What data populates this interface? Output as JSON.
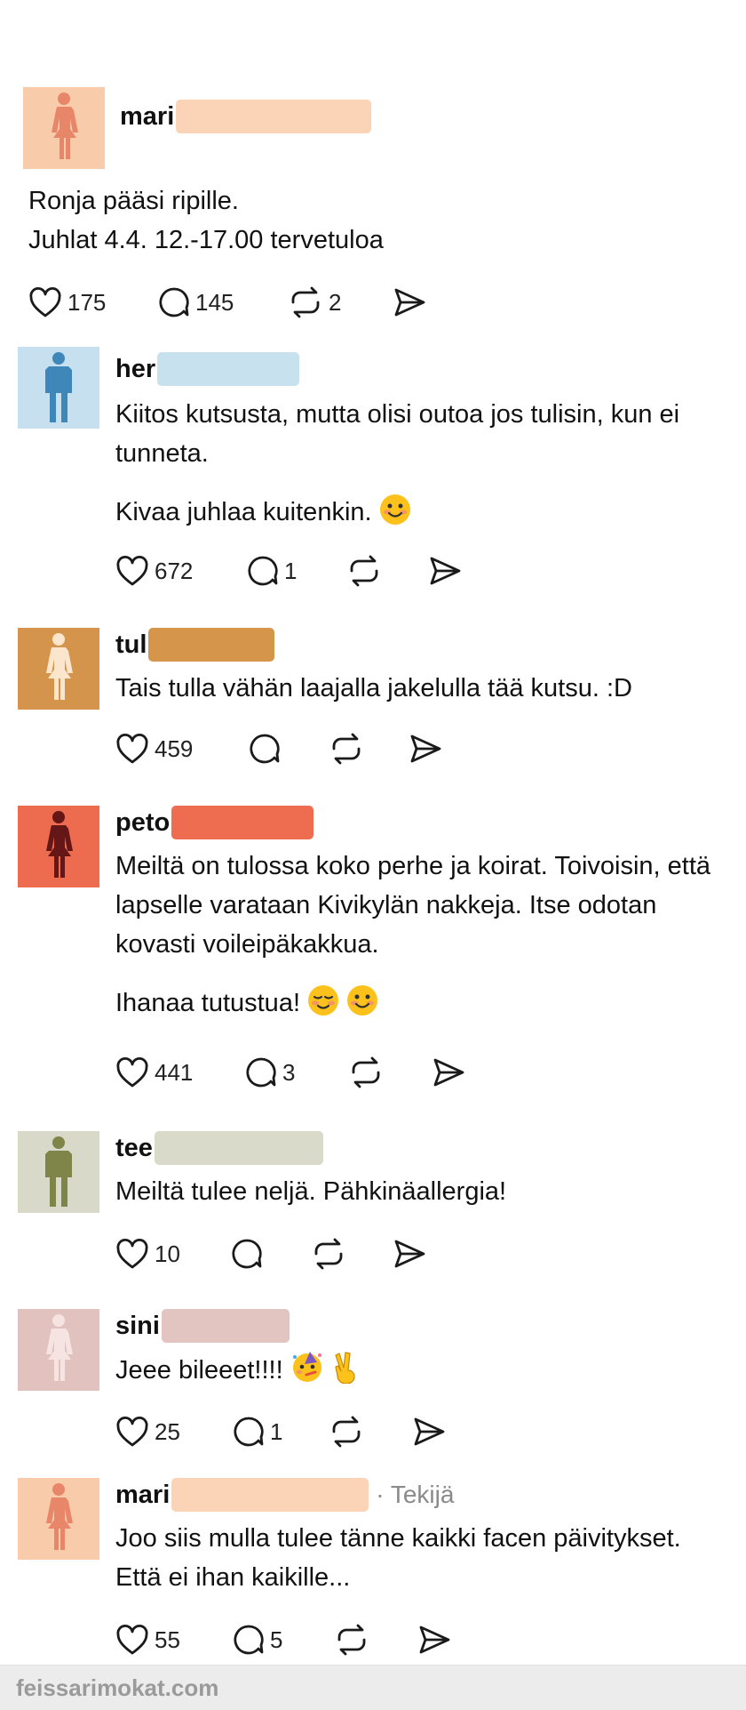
{
  "post": {
    "username_visible": "mari",
    "lines": [
      "Ronja pääsi ripille.",
      "Juhlat 4.4. 12.-17.00 tervetuloa"
    ],
    "likes": "175",
    "comments": "145",
    "reposts": "2",
    "avatar_color": "#f8ccab",
    "figure_color": "#e8866a",
    "blur_color": "#fbd3b7"
  },
  "replies": [
    {
      "username_visible": "her",
      "paragraphs": [
        "Kiitos kutsusta, mutta olisi outoa jos tulisin, kun ei tunneta.",
        "Kivaa juhlaa kuitenkin."
      ],
      "emojis": [
        "smiling-face-icon"
      ],
      "likes": "672",
      "comments": "1",
      "reposts": "",
      "avatar_color": "#c6e0ef",
      "figure_color": "#3f87b9",
      "blur_color": "#c7e1ef",
      "figure": "man"
    },
    {
      "username_visible": "tul",
      "paragraphs": [
        "Tais tulla vähän laajalla jakelulla tää kutsu. :D"
      ],
      "emojis": [],
      "likes": "459",
      "comments": "",
      "reposts": "",
      "avatar_color": "#d4944b",
      "figure_color": "#fbe6cd",
      "blur_color": "#d5964c",
      "figure": "woman"
    },
    {
      "username_visible": "peto",
      "paragraphs": [
        "Meiltä on tulossa koko perhe ja koirat. Toivoisin, että lapselle varataan Kivikylän nakkeja. Itse odotan kovasti voileipäkakkua.",
        "Ihanaa tutustua!"
      ],
      "emojis": [
        "relieved-face-icon",
        "smiling-face-icon"
      ],
      "likes": "441",
      "comments": "3",
      "reposts": "",
      "avatar_color": "#ed6b4f",
      "figure_color": "#651616",
      "blur_color": "#ee6c50",
      "figure": "woman"
    },
    {
      "username_visible": "tee",
      "paragraphs": [
        "Meiltä tulee neljä. Pähkinäallergia!"
      ],
      "emojis": [],
      "likes": "10",
      "comments": "",
      "reposts": "",
      "avatar_color": "#d8d9c8",
      "figure_color": "#7f8448",
      "blur_color": "#d9dac9",
      "figure": "man"
    },
    {
      "username_visible": "sini",
      "paragraphs": [
        "Jeee bileeet!!!!"
      ],
      "emojis": [
        "party-face-icon",
        "victory-hand-icon"
      ],
      "likes": "25",
      "comments": "1",
      "reposts": "",
      "avatar_color": "#e2c2bf",
      "figure_color": "#f6e4e2",
      "blur_color": "#e2c4c1",
      "figure": "woman"
    },
    {
      "username_visible": "mari",
      "author_tag": "· Tekijä",
      "paragraphs": [
        "Joo siis mulla tulee tänne kaikki facen päivitykset. Että ei ihan kaikille..."
      ],
      "emojis": [],
      "likes": "55",
      "comments": "5",
      "reposts": "",
      "avatar_color": "#f8ccab",
      "figure_color": "#e8866a",
      "blur_color": "#fbd3b7",
      "figure": "woman"
    }
  ],
  "watermark": "feissarimokat.com"
}
